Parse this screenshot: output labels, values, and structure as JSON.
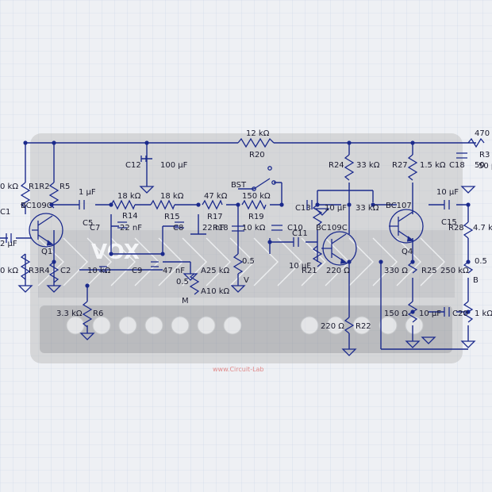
{
  "background": {
    "grid_color": "#c9d3e6",
    "wire_color": "#1b2a8c",
    "photo_brand": "VOX",
    "photo_caption": "www.Circuit-Lab"
  },
  "labels": {
    "r20_val": "12 kΩ",
    "r20": "R20",
    "r470": "470",
    "r3": "R3",
    "r50": "50 p",
    "c12": "C12",
    "c12_val": "100 µF",
    "r24": "R24",
    "r24_val": "33 kΩ",
    "r27": "R27",
    "r27_val": "1.5 kΩ",
    "c18": "C18",
    "c18_val": "50",
    "okohm": "0 kΩ",
    "r_rr": "R1R2",
    "r5": "R5",
    "bst": "BST",
    "c2_val": "1 µF",
    "r14_val": "18 kΩ",
    "r15_val": "18 kΩ",
    "r17_val": "47 kΩ",
    "r19_val": "150 kΩ",
    "bc109c_a": "BC109C",
    "c1": "C1",
    "r14": "R14",
    "r15": "R15",
    "r17": "R17",
    "r19": "R19",
    "c5": "C5",
    "c7": "C7",
    "c7_val": "22 nF",
    "c8": "C8",
    "c8_val": "22 nF",
    "r18": "R18",
    "r18_val": "10 kΩ",
    "c10": "C10",
    "c11": "C11",
    "c13": "C13",
    "c13_val": "10 µF",
    "r22_33": "33 kΩ",
    "bc107": "BC107",
    "bc109c_b": "BC109C",
    "c15": "C15",
    "r28": "R28",
    "r28_val": "4.7 k",
    "c_10uf": "10 µF",
    "q1": "Q1",
    "q4": "Q4",
    "left_uf": "2 µF",
    "ok2": "0 kΩ",
    "r3b": "R3R4",
    "c2": "C2",
    "r10_val": "10 kΩ",
    "c9": "C9",
    "c9_val": "47 nF",
    "pot05": "0.5",
    "a25": "A25 kΩ",
    "v": "V",
    "pot05b": "0.5",
    "a10": "A10 kΩ",
    "m": "M",
    "c10_val": "10 µF",
    "r21": "R21",
    "r21_val": "220 Ω",
    "r330": "330 Ω",
    "r25": "R25",
    "r250": "250 kΩ",
    "pot05c": "0.5",
    "b": "B",
    "r6_val": "3.3 kΩ",
    "r6": "R6",
    "r22_val": "220 Ω",
    "r22": "R22",
    "r150": "150 Ω",
    "c20_val": "10 µF",
    "c20": "C20",
    "r1k": "1 kΩ"
  }
}
